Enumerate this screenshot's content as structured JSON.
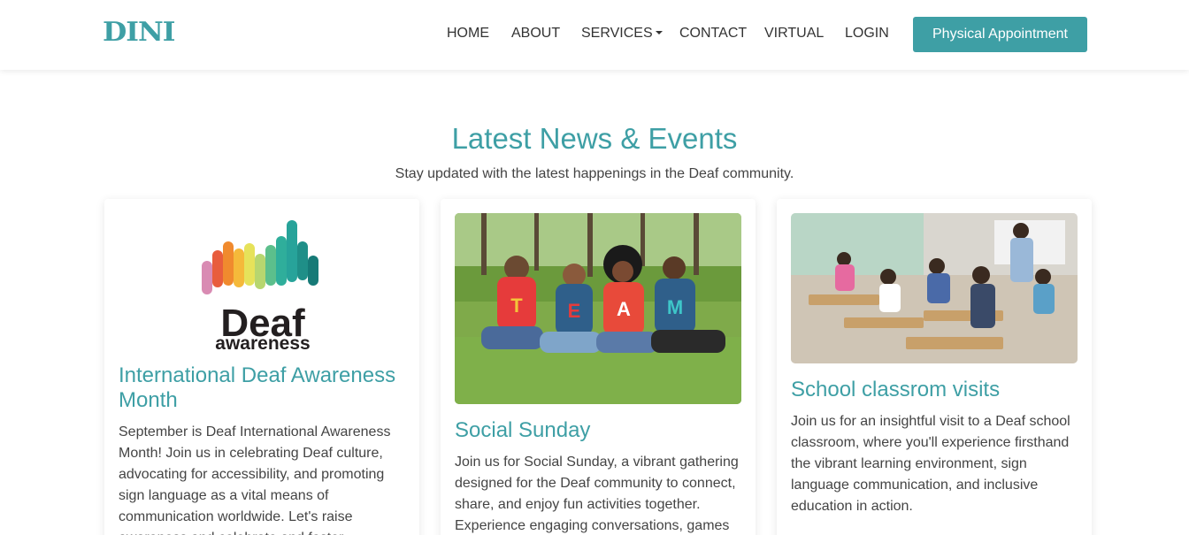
{
  "nav": {
    "logo": "DINI",
    "items": [
      {
        "label": "HOME"
      },
      {
        "label": "ABOUT"
      },
      {
        "label": "SERVICES"
      },
      {
        "label": "CONTACT"
      },
      {
        "label": "VIRTUAL"
      },
      {
        "label": "LOGIN"
      }
    ],
    "cta_label": "Physical Appointment"
  },
  "section": {
    "title": "Latest News & Events",
    "subtitle": "Stay updated with the latest happenings in the Deaf community."
  },
  "cards": [
    {
      "image_text_main": "Deaf",
      "image_text_sub": "awareness",
      "title": "International Deaf Awareness Month",
      "text": "September is Deaf International Awareness Month! Join us in celebrating Deaf culture, advocating for accessibility, and promoting sign language as a vital means of communication worldwide. Let's raise awareness and celebrate and foster"
    },
    {
      "image_shirt_letters": [
        "T",
        "E",
        "A",
        "M"
      ],
      "title": "Social Sunday",
      "text": "Join us for Social Sunday, a vibrant gathering designed for the Deaf community to connect, share, and enjoy fun activities together. Experience engaging conversations, games"
    },
    {
      "title": "School classrom visits",
      "text": "Join us for an insightful visit to a Deaf school classroom, where you'll experience firsthand the vibrant learning environment, sign language communication, and inclusive education in action."
    }
  ],
  "colors": {
    "brand": "#3e9fa5",
    "text": "#444444",
    "nav_text": "#333333"
  }
}
